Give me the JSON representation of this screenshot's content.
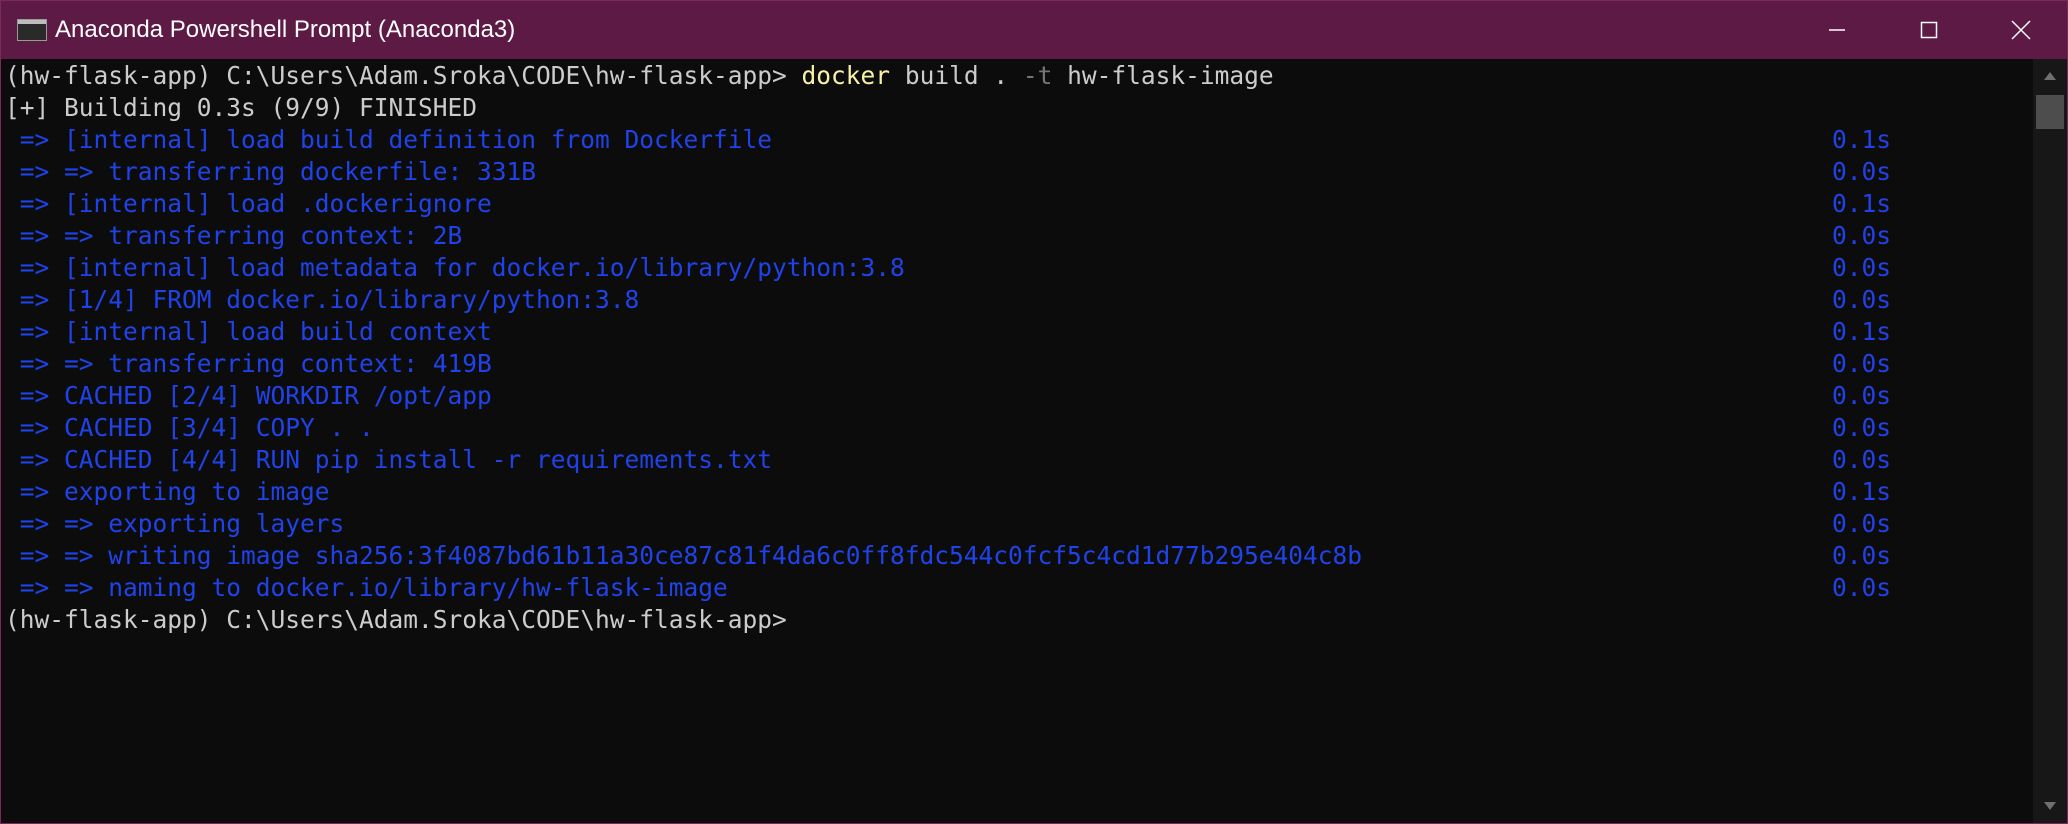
{
  "window": {
    "title": "Anaconda Powershell Prompt (Anaconda3)",
    "icon": "console-icon",
    "controls": [
      "minimize-icon",
      "maximize-icon",
      "close-icon"
    ]
  },
  "colors": {
    "titlebar": "#5c1a45",
    "background": "#0c0c0c",
    "text": "#cccccc",
    "command": "#f9f1a5",
    "flag": "#767676",
    "build_output": "#1f43e8"
  },
  "terminal": {
    "prompt": "(hw-flask-app) C:\\Users\\Adam.Sroka\\CODE\\hw-flask-app>",
    "command": {
      "name": "docker",
      "args1": "build .",
      "flag": "-t",
      "args2": "hw-flask-image"
    },
    "status": "[+] Building 0.3s (9/9) FINISHED",
    "steps": [
      {
        "text": " => [internal] load build definition from Dockerfile",
        "time": "0.1s"
      },
      {
        "text": " => => transferring dockerfile: 331B",
        "time": "0.0s"
      },
      {
        "text": " => [internal] load .dockerignore",
        "time": "0.1s"
      },
      {
        "text": " => => transferring context: 2B",
        "time": "0.0s"
      },
      {
        "text": " => [internal] load metadata for docker.io/library/python:3.8",
        "time": "0.0s"
      },
      {
        "text": " => [1/4] FROM docker.io/library/python:3.8",
        "time": "0.0s"
      },
      {
        "text": " => [internal] load build context",
        "time": "0.1s"
      },
      {
        "text": " => => transferring context: 419B",
        "time": "0.0s"
      },
      {
        "text": " => CACHED [2/4] WORKDIR /opt/app",
        "time": "0.0s"
      },
      {
        "text": " => CACHED [3/4] COPY . .",
        "time": "0.0s"
      },
      {
        "text": " => CACHED [4/4] RUN pip install -r requirements.txt",
        "time": "0.0s"
      },
      {
        "text": " => exporting to image",
        "time": "0.1s"
      },
      {
        "text": " => => exporting layers",
        "time": "0.0s"
      },
      {
        "text": " => => writing image sha256:3f4087bd61b11a30ce87c81f4da6c0ff8fdc544c0fcf5c4cd1d77b295e404c8b",
        "time": "0.0s"
      },
      {
        "text": " => => naming to docker.io/library/hw-flask-image",
        "time": "0.0s"
      }
    ],
    "final_prompt": "(hw-flask-app) C:\\Users\\Adam.Sroka\\CODE\\hw-flask-app>"
  }
}
